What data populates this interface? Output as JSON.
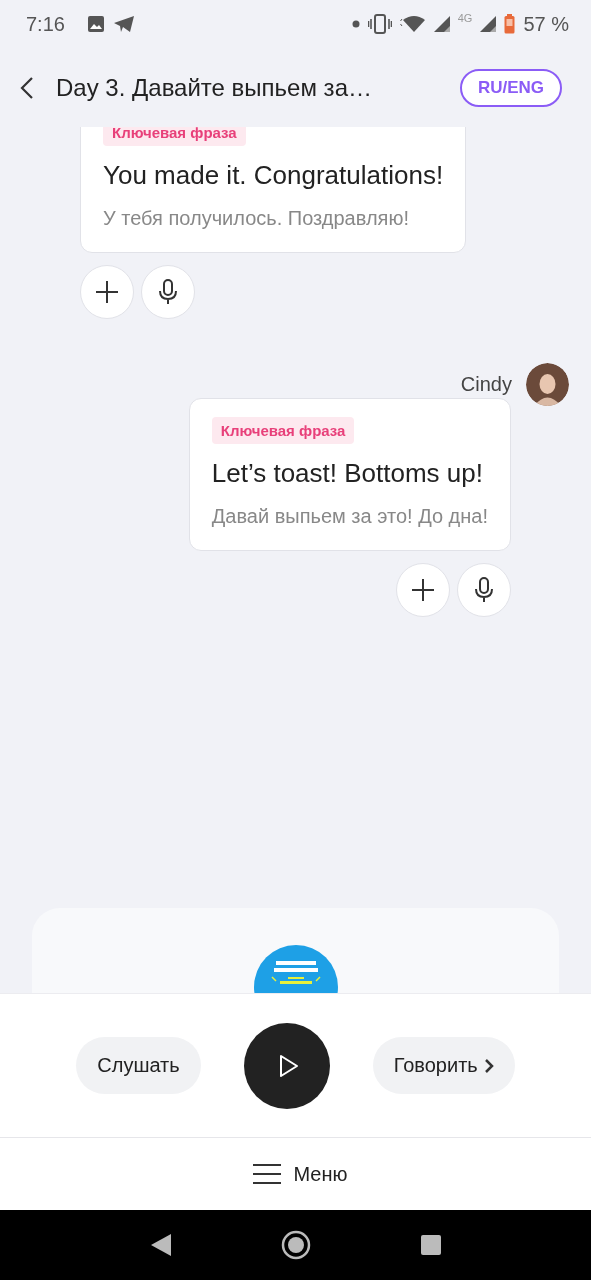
{
  "status_bar": {
    "time": "7:16",
    "network": "4G",
    "battery": "57 %"
  },
  "header": {
    "title": "Day 3. Давайте выпьем за…",
    "language_button": "RU/ENG"
  },
  "messages": [
    {
      "kind": "incoming",
      "tag": "Ключевая фраза",
      "phrase": "You made it. Congratulations!",
      "translation": "У тебя получилось. Поздравляю!"
    },
    {
      "kind": "outgoing",
      "author": "Cindy",
      "tag": "Ключевая фраза",
      "phrase": "Let’s toast! Bottoms up!",
      "translation": "Давай выпьем за это! До дна!"
    }
  ],
  "player": {
    "listen": "Слушать",
    "speak": "Говорить"
  },
  "menu": {
    "label": "Меню"
  }
}
